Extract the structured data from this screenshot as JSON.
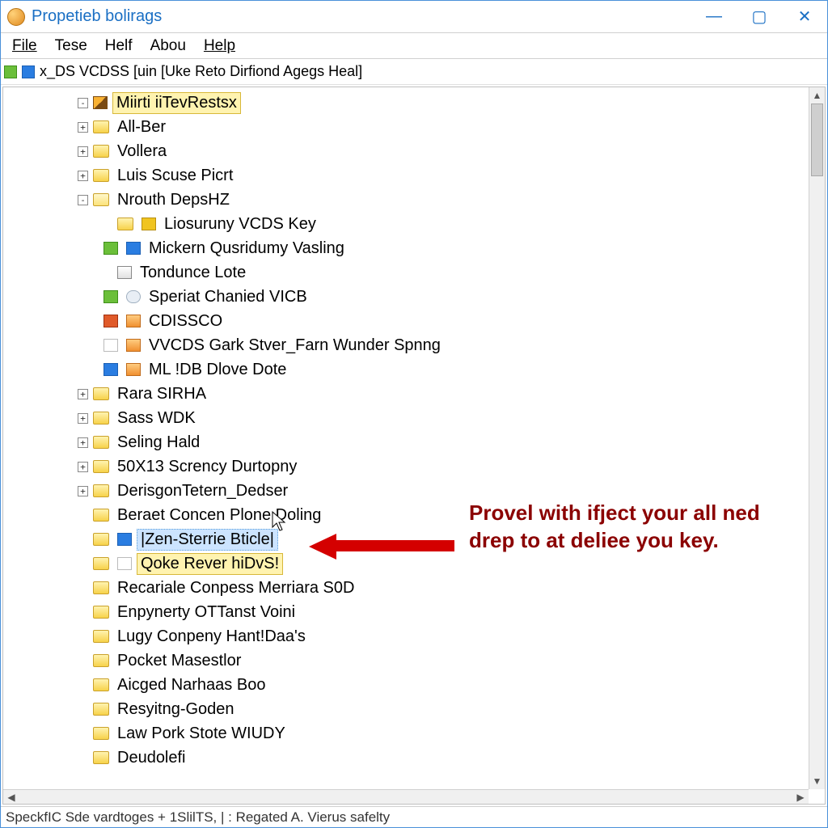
{
  "title": "Propetieb bolirags",
  "menu": [
    "File",
    "Tese",
    "Helf",
    "Abou",
    "Help"
  ],
  "pathbar": "x_DS VCDSS [uin [Uke Reto Dirfiond Agegs Heal]",
  "status": "SpeckfIC Sde vardtoges + 1SlilTS, | : Regated A. Vierus safelty",
  "annotation": "Provel with ifject your all ned drep to at deliee you key.",
  "tree": {
    "root_selected": "Miirti iiTevRestsx",
    "level1": [
      "All-Ber",
      "Vollera",
      "Luis Scuse Picrt",
      "Nrouth DepsHZ"
    ],
    "level2": [
      "Liosuruny VCDS Key",
      "Mickern Qusridumy Vasling",
      "Tondunce Lote",
      "Speriat Chanied VICB",
      "CDISSCO",
      "VVCDS Gark Stver_Farn Wunder Spnng",
      "ML !DB Dlove Dote"
    ],
    "level1b": [
      "Rara SIRHA",
      "Sass WDK",
      "Seling Hald",
      "50X13 Scrency Durtopny",
      "DerisgonTetern_Dedser",
      "Beraet Concen Plone Doling"
    ],
    "blue_selected": "|Zen-Sterrie Bticle|",
    "yellow_selected": "Qoke Rever hiDvS!",
    "level1c": [
      "Recariale Conpess Merriara S0D",
      "Enpynerty OTTanst Voini",
      "Lugy Conpeny Hant!Daa's",
      "Pocket Masestlor",
      "Aicged Narhaas Boo",
      "Resyitng-Goden",
      "Law Pork Stote WIUDY",
      "Deudolefi"
    ]
  }
}
